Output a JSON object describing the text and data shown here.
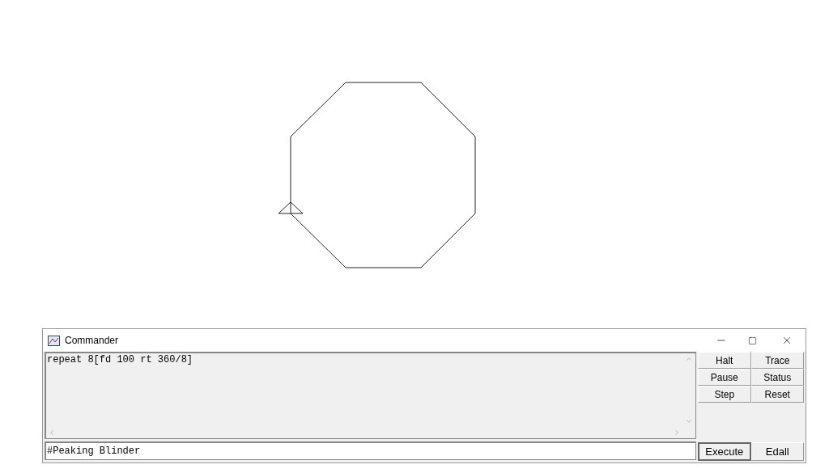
{
  "window": {
    "title": "Commander"
  },
  "history": {
    "lines": [
      "repeat 8[fd 100 rt 360/8]"
    ]
  },
  "input": {
    "value": "#Peaking Blinder"
  },
  "control_buttons": [
    {
      "label": "Halt"
    },
    {
      "label": "Trace"
    },
    {
      "label": "Pause"
    },
    {
      "label": "Status"
    },
    {
      "label": "Step"
    },
    {
      "label": "Reset"
    }
  ],
  "action_buttons": [
    {
      "label": "Execute",
      "default": true
    },
    {
      "label": "Edall",
      "default": false
    }
  ]
}
